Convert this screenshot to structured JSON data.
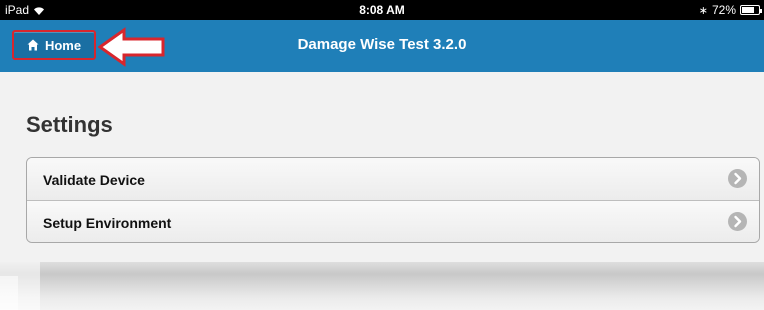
{
  "status_bar": {
    "device": "iPad",
    "time": "8:08 AM",
    "battery": "72%",
    "battery_level": 0.72
  },
  "nav_bar": {
    "home_label": "Home",
    "title": "Damage Wise Test 3.2.0",
    "color": "#1f7fb8"
  },
  "page": {
    "title": "Settings"
  },
  "settings": {
    "items": [
      {
        "label": "Validate Device"
      },
      {
        "label": "Setup Environment"
      }
    ]
  },
  "icons": [
    "wifi-icon",
    "bluetooth-icon",
    "battery-icon",
    "home-icon",
    "arrow-icon",
    "chevron-right-icon"
  ],
  "colors": {
    "highlight": "#d8262d"
  }
}
